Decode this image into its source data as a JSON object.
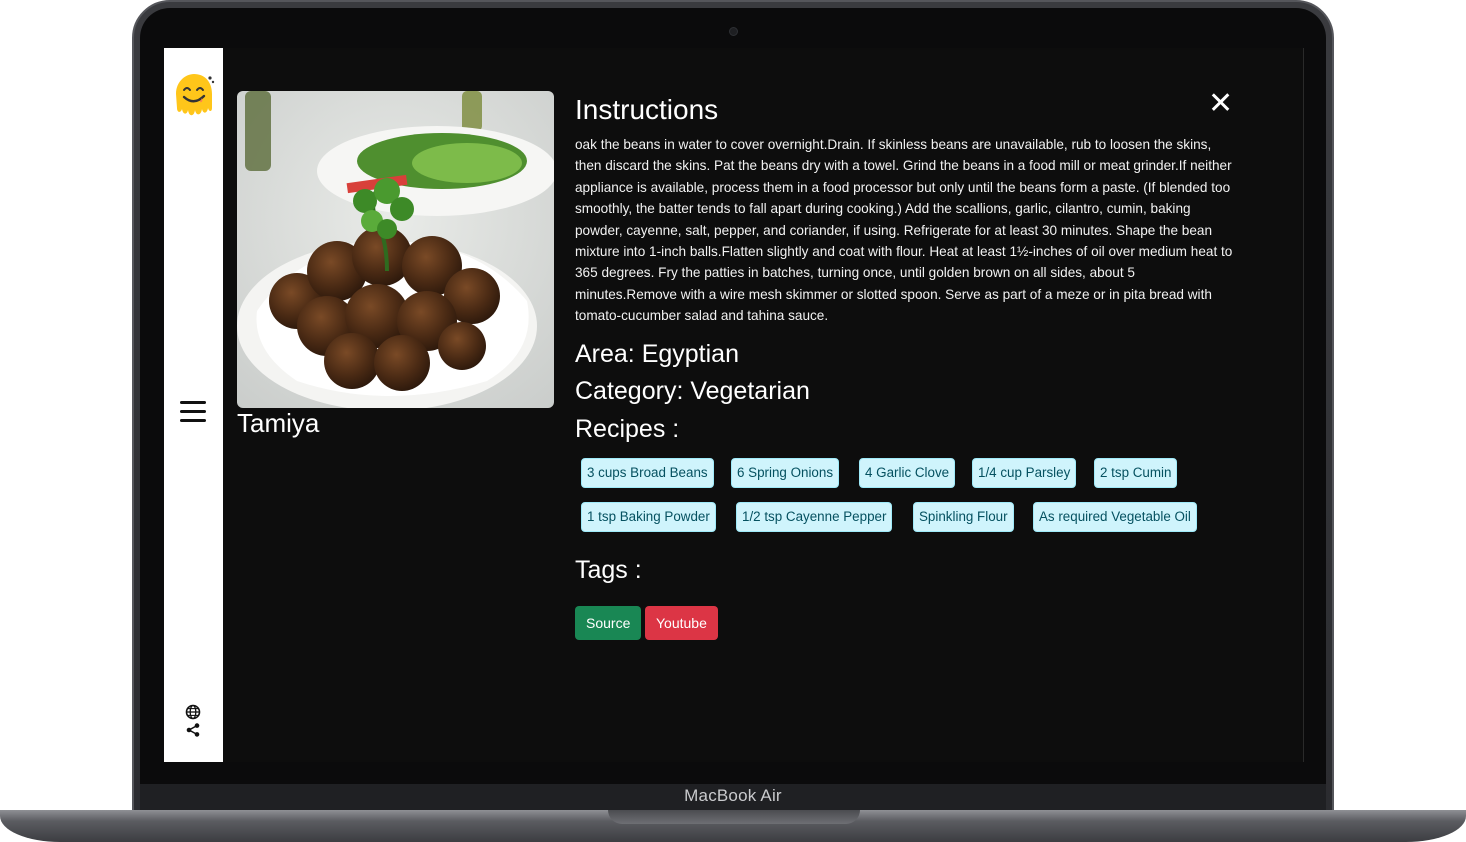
{
  "device": {
    "label": "MacBook Air"
  },
  "meal": {
    "name": "Tamiya",
    "image_alt": "falafel-plate-photo"
  },
  "instructions": {
    "title": "Instructions",
    "text": "oak the beans in water to cover overnight.Drain. If skinless beans are unavailable, rub to loosen the skins, then discard the skins. Pat the beans dry with a towel. Grind the beans in a food mill or meat grinder.If neither appliance is available, process them in a food processor but only until the beans form a paste. (If blended too smoothly, the batter tends to fall apart during cooking.) Add the scallions, garlic, cilantro, cumin, baking powder, cayenne, salt, pepper, and coriander, if using. Refrigerate for at least 30 minutes. Shape the bean mixture into 1-inch balls.Flatten slightly and coat with flour. Heat at least 1½-inches of oil over medium heat to 365 degrees. Fry the patties in batches, turning once, until golden brown on all sides, about 5 minutes.Remove with a wire mesh skimmer or slotted spoon. Serve as part of a meze or in pita bread with tomato-cucumber salad and tahina sauce."
  },
  "area": {
    "label": "Area: Egyptian"
  },
  "category": {
    "label": "Category: Vegetarian"
  },
  "recipes": {
    "label": "Recipes :",
    "items": [
      "3 cups Broad Beans",
      "6 Spring Onions",
      "4 Garlic Clove",
      "1/4 cup Parsley",
      "2 tsp Cumin",
      "1 tsp Baking Powder",
      "1/2 tsp Cayenne Pepper",
      "Spinkling Flour",
      "As required Vegetable Oil"
    ]
  },
  "tags": {
    "label": "Tags :",
    "source_label": "Source",
    "youtube_label": "Youtube"
  },
  "colors": {
    "screen_bg": "#0d0d0d",
    "sidebar_bg": "#ffffff",
    "chip_bg": "#cff4fc",
    "chip_text": "#055160",
    "source_btn": "#198754",
    "youtube_btn": "#dc3545"
  },
  "icons": {
    "logo": "smiley-logo-icon",
    "menu": "hamburger-menu-icon",
    "globe": "globe-icon",
    "share": "share-icon",
    "close": "close-icon"
  }
}
